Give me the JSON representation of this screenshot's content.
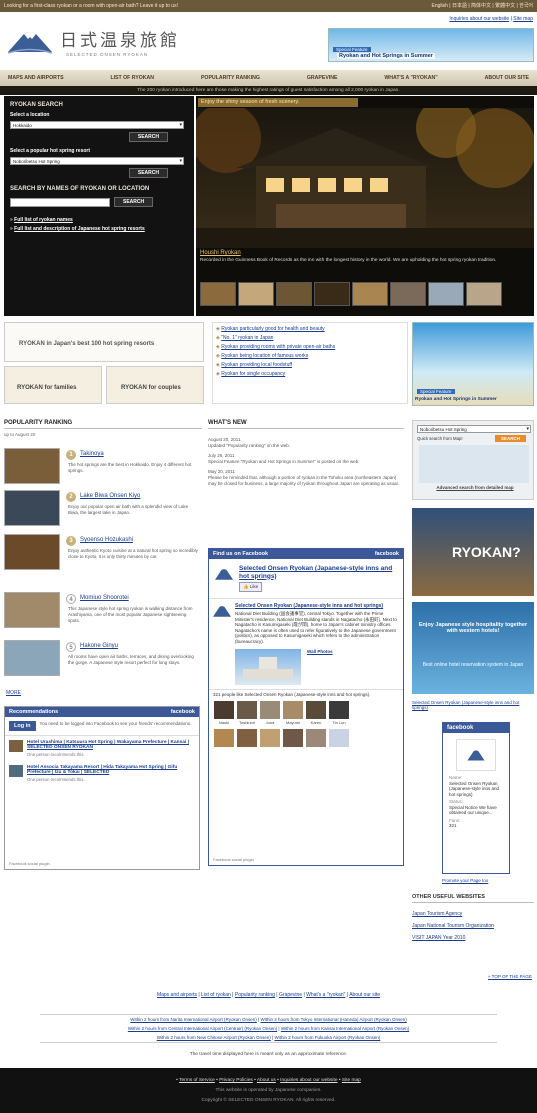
{
  "topbar": {
    "notice": "Looking for a first-class ryokan or a room with open-air bath? Leave it up to us!",
    "langs": "English | 日本語 | 简体中文 | 繁體中文 | 한국어"
  },
  "header": {
    "logo_jp": "日式温泉旅館",
    "logo_en": "SELECTED ONSEN RYOKAN",
    "util_links": [
      "Inquiries about our website",
      "Site map"
    ],
    "banner_label": "Special Feature",
    "banner_text": "Ryokan and Hot Springs in Summer"
  },
  "nav": [
    "MAPS AND AIRPORTS",
    "LIST OF RYOKAN",
    "POPULARITY RANKING",
    "GRAPEVINE",
    "WHAT'S A \"RYOKAN\"",
    "ABOUT OUR SITE"
  ],
  "tagline": "The 200 ryokan introduced here are those making the highest ratings of guest satisfaction among all 2,000 ryokan in Japan.",
  "search": {
    "title": "RYOKAN SEARCH",
    "location_label": "Select a location",
    "location_value": "Hokkaido",
    "search_btn": "SEARCH",
    "resort_label": "Select a popular hot spring resort",
    "resort_value": "Noboribetsu Hot Spring",
    "name_label": "SEARCH BY NAMES OF RYOKAN OR LOCATION",
    "name_value": "",
    "links": [
      "Full list of ryokan names",
      "Full list and description of Japanese hot spring resorts"
    ]
  },
  "hero": {
    "caption": "Enjoy the shiny season of fresh scenery.",
    "title": "Houshi Ryokan",
    "desc": "Recorded in the Guinness Book of Records as the inn with the longest history in the world. We are upholding the hot spring ryokan tradition."
  },
  "promo": {
    "best100": "RYOKAN in Japan's best 100 hot spring resorts",
    "families": "RYOKAN for families",
    "couples": "RYOKAN for couples"
  },
  "features": [
    "Ryokan particularly good for health and beauty",
    "\"No. 1\" ryokan in Japan",
    "Ryokan providing rooms with private open-air baths",
    "Ryokan being location of famous works",
    "Ryokan providing local foodstuff",
    "Ryokan for single occupancy"
  ],
  "right_banner": {
    "label": "Special Feature",
    "text": "Ryokan and Hot Springs in Summer"
  },
  "quick_search": {
    "select": "Noboribetsu Hot Spring",
    "label": "Quick search from Map!",
    "btn": "SEARCH",
    "adv": "Advanced search from detailed map"
  },
  "ryokan_banner": "RYOKAN?",
  "foreign_banner": {
    "line1": "Enjoy Japanese style hospitality together with western hotels!",
    "line2": "Best online hotel reservation system in Japan"
  },
  "ranking": {
    "title": "POPULARITY RANKING",
    "period": "up to August 20",
    "items": [
      {
        "num": "1",
        "name": "Takinoya",
        "desc": "The hot springs are the best in Hokkaido. Enjoy 4 different hot springs."
      },
      {
        "num": "2",
        "name": "Lake Biwa Onsen Kiyo",
        "desc": "Enjoy our popular open air bath with a splendid view of Lake Biwa, the largest lake in Japan."
      },
      {
        "num": "3",
        "name": "Syoenso Hozukashi",
        "desc": "Enjoy authentic Kyoto cuisine at a natural hot spring so incredibly close to Kyoto, it is only thirty minutes by car."
      },
      {
        "num": "4",
        "name": "Momiuo Shoorotei",
        "desc": "This Japanese style hot spring ryokan is walking distance from Arashiyama, one of the most popular Japanese sightseeing spots."
      },
      {
        "num": "5",
        "name": "Hakone Ginyu",
        "desc": "All rooms have open air baths, terraces, and dining overlooking the gorge. A Japanese style resort perfect for long stays."
      }
    ],
    "more": "MORE"
  },
  "recommend": {
    "title": "Recommendations",
    "fb": "facebook",
    "login": "Log in",
    "login_text": "You need to be logged into Facebook to see your friends' recommendations.",
    "items": [
      {
        "title": "Hotel Urashima | Katsuura Hot Spring | Wakayama Prefecture | Kansai | SELECTED ONSEN RYOKAN",
        "note": "One person recommends this."
      },
      {
        "title": "Hotel Associa Takayama Resort | Hida Takayama Hot Spring | Gifu Prefecture | Izu & Tokai | SELECTED",
        "note": "One person recommends this."
      }
    ],
    "plugin": "Facebook social plugin"
  },
  "whatsnew": {
    "title": "WHAT'S NEW",
    "entries": [
      {
        "date": "August 20, 2011",
        "text": "Updated \"Popularity ranking\" on the web."
      },
      {
        "date": "July 26, 2011",
        "text": "Special Feature \"Ryokan and Hot Springs in Summer\" is posted on the web."
      },
      {
        "date": "May 20, 2011",
        "text": "Please be reminded that, although a portion of ryokan in the Tohoku area (northeastern Japan) may be closed for business, a large majority of ryokan throughout Japan are operating as usual."
      }
    ]
  },
  "fb_box": {
    "header": "Find us on Facebook",
    "fb": "facebook",
    "page_name": "Selected Onsen Ryokan (Japanese-style inns and hot springs)",
    "like": "Like",
    "post_title": "Selected Onsen Ryokan (Japanese-style inns and hot springs)",
    "post_text": "National Diet Building (国会議事堂), central Tokyo. Together with the Prime Minister's residence, National Diet Building stands in Nagatacho (永田町). Next to Nagatacho is Kasumigaseki (霞が関), home to Japan's cabinet ministry offices. Nagatacho's name is often used to refer figuratively to the Japanese government (politics), as opposed to Kasumigaseki which refers to the administration (bureaucracy).",
    "wall": "Wall Photos",
    "likes_text": "321 people like Selected Onsen Ryokan (Japanese-style inns and hot springs).",
    "fans": [
      "Naoki",
      "Toshinori",
      "Juna",
      "Mayumi",
      "Karen",
      "Tin Lun"
    ],
    "plugin": "Facebook social plugin"
  },
  "right_fb": {
    "caption": "Selected Onsen Ryokan (Japanese-style inns and hot springs)",
    "head": "facebook",
    "name_label": "Name:",
    "name": "Selected Onsen Ryokan (Japanese-style inns and hot springs)",
    "status_label": "Status:",
    "status": "Special Notice We have obtained our unique...",
    "fans_label": "Fans:",
    "fans": "321",
    "promote": "Promote your Page too"
  },
  "other_sites": {
    "title": "OTHER USEFUL WEBSITES",
    "links": [
      "Japan Tourism Agency",
      "Japan National Tourism Organization",
      "VISIT JAPAN Year 2010"
    ]
  },
  "top_link": "TOP OF THE PAGE",
  "footer": {
    "nav": [
      "Maps and airports",
      "List of ryokan",
      "Popularity ranking",
      "Grapevine",
      "What's a \"ryokan\"",
      "About our site"
    ],
    "airports": [
      "Within 2 hours from Narita International Airport (Ryokan Onsen)",
      "Within 2 hours from Tokyo International (Haneda) Airport (Ryokan Onsen)",
      "Within 2 hours from Central International Airport (Centrair) (Ryokan Onsen)",
      "Within 2 hours from Kansai International Airport (Ryokan Onsen)",
      "Within 2 hours from New Chitose Airport (Ryokan Onsen)",
      "Within 2 hours from Fukuoka Airport (Ryokan Onsen)"
    ],
    "note": "The travel time displayed here is meant only as an approximate reference.",
    "bottom_links": [
      "Terms of Service",
      "Privacy Policies",
      "About us",
      "Inquiries about our website",
      "Site map"
    ],
    "operated": "This website is operated by Japanese companies.",
    "copyright": "Copyright © SELECTED ONSEN RYOKAN. All rights reserved."
  }
}
